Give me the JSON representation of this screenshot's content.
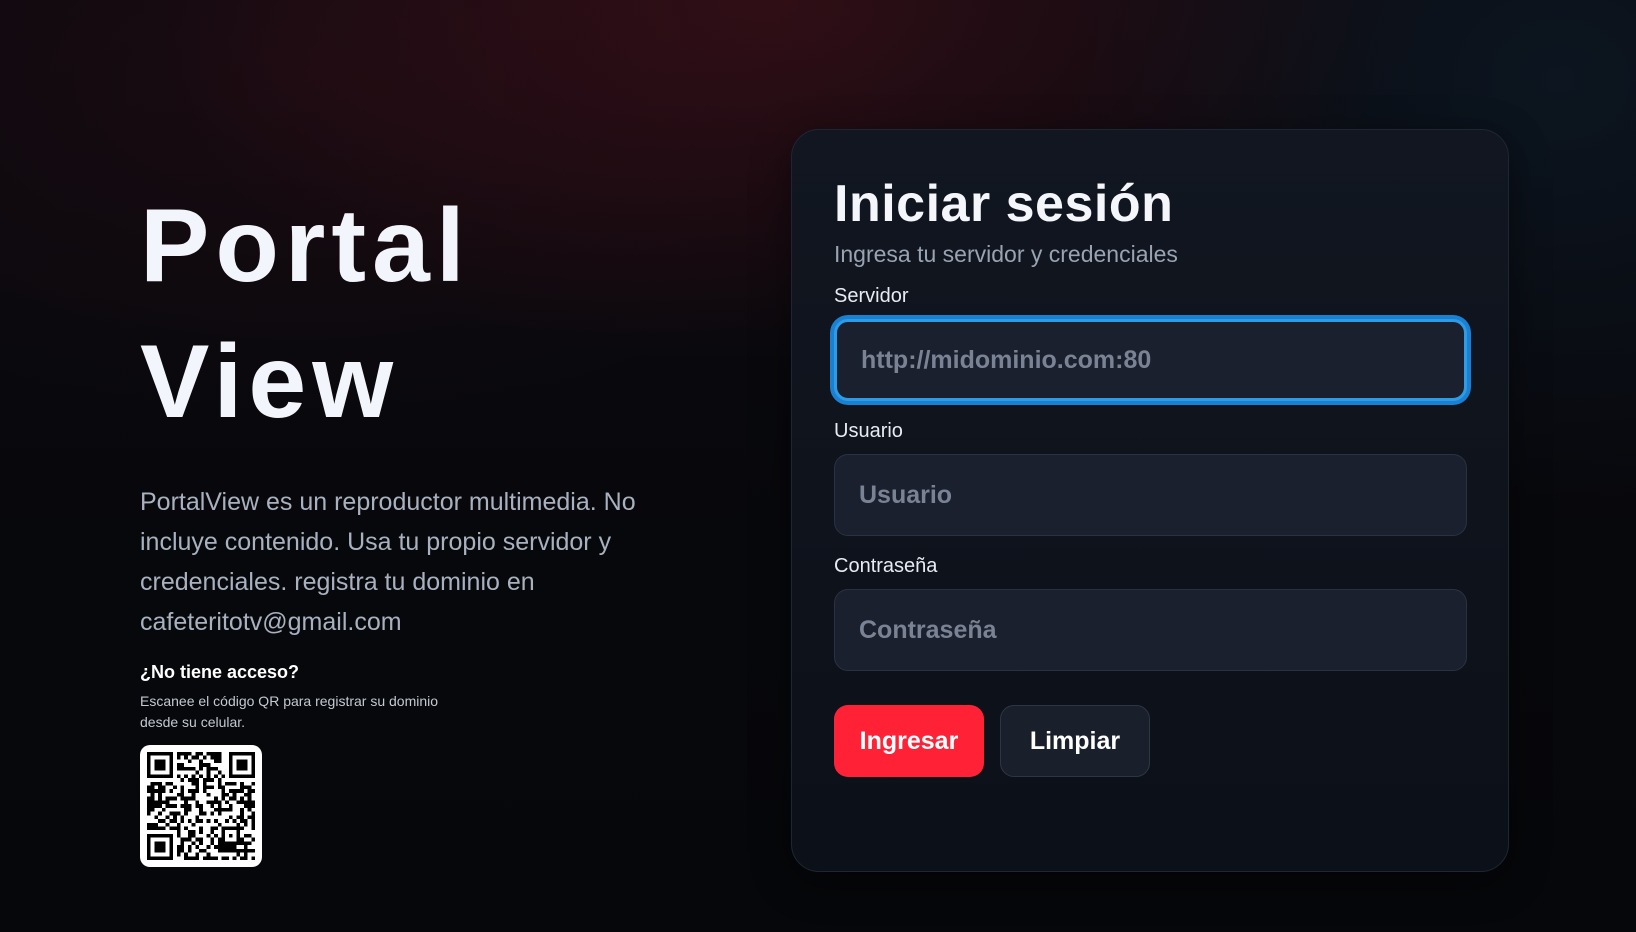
{
  "hero": {
    "title": "Portal View",
    "description": "PortalView es un reproductor multimedia. No incluye contenido. Usa tu propio servidor y credenciales. registra tu dominio en cafeteritotv@gmail.com",
    "no_access_title": "¿No tiene acceso?",
    "no_access_text": "Escanee el código QR para registrar su dominio desde su celular.",
    "qr_icon": "qr-code-icon"
  },
  "login": {
    "title": "Iniciar sesión",
    "subtitle": "Ingresa tu servidor y credenciales",
    "server": {
      "label": "Servidor",
      "value": "",
      "placeholder": "http://midominio.com:80"
    },
    "user": {
      "label": "Usuario",
      "value": "",
      "placeholder": "Usuario"
    },
    "password": {
      "label": "Contraseña",
      "value": "",
      "placeholder": "Contraseña"
    },
    "submit_label": "Ingresar",
    "clear_label": "Limpiar"
  },
  "colors": {
    "accent": "#ff2236",
    "focus": "#2e9be6",
    "card_bg": "#111620",
    "field_bg": "#1b202e"
  }
}
